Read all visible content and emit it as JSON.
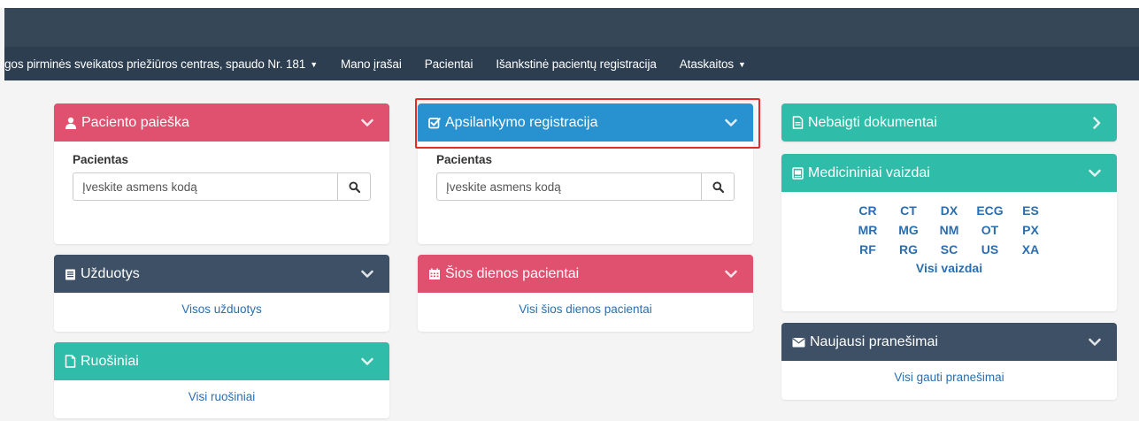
{
  "navbar": {
    "org": "gos pirminės sveikatos priežiūros centras, spaudo Nr. 181",
    "items": [
      "Mano įrašai",
      "Pacientai",
      "Išankstinė pacientų registracija"
    ],
    "reports": "Ataskaitos"
  },
  "patient_search": {
    "title": "Paciento paieška",
    "label": "Pacientas",
    "placeholder": "Įveskite asmens kodą"
  },
  "tasks": {
    "title": "Užduotys",
    "link": "Visos užduotys"
  },
  "drafts": {
    "title": "Ruošiniai",
    "link": "Visi ruošiniai"
  },
  "visit_registration": {
    "title": "Apsilankymo registracija",
    "label": "Pacientas",
    "placeholder": "Įveskite asmens kodą"
  },
  "today_patients": {
    "title": "Šios dienos pacientai",
    "link": "Visi šios dienos pacientai"
  },
  "unfinished_docs": {
    "title": "Nebaigti dokumentai"
  },
  "medical_images": {
    "title": "Medicininiai vaizdai",
    "modalities": [
      "CR",
      "CT",
      "DX",
      "ECG",
      "ES",
      "MR",
      "MG",
      "NM",
      "OT",
      "PX",
      "RF",
      "RG",
      "SC",
      "US",
      "XA"
    ],
    "link": "Visi vaizdai"
  },
  "messages": {
    "title": "Naujausi pranešimai",
    "link": "Visi gauti pranešimai"
  },
  "colors": {
    "pink": "#e0506f",
    "blue": "#2891cf",
    "teal": "#2fbca8",
    "navy": "#3d5066",
    "navbar": "#2c3e50",
    "link": "#2a6eb0",
    "highlight": "#e52a2a"
  }
}
